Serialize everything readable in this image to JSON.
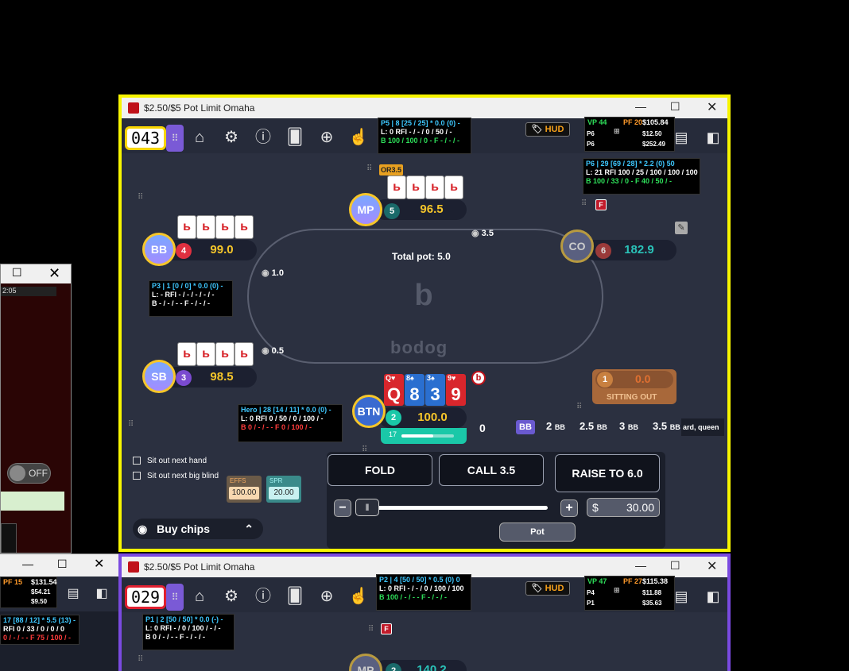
{
  "left_window_top": {
    "time_partial": "2:05",
    "toggle_label": "OFF"
  },
  "left_window_bottom": {
    "hud_vp": "PF 15",
    "hud_amt1": "$131.54",
    "hud_amt2": "$54.21",
    "hud_amt3": "$9.50",
    "hud_line1": "17 [88 / 12] * 5.5 (13) -",
    "hud_line2": "RFI 0 / 33 / 0 / 0 / 0",
    "hud_line3": "0 / - / - - F 75 / 100 / -"
  },
  "main": {
    "title": "$2.50/$5 Pot Limit Omaha",
    "hand_count": "043",
    "hud_button": "HUD",
    "vp_stats": {
      "vp": "VP 44",
      "pf": "PF 20",
      "amt1": "$105.84",
      "amt2": "$12.50",
      "amt3": "$252.49",
      "p1": "P6",
      "p2": "P6"
    },
    "p5_hud": {
      "l1": "P5 | 8 [25 / 25] * 0.0 (0) -",
      "l2": "L: 0 RFI - / - / 0 / 50 / -",
      "l3": "B 100 / 100 / 0 - F - / - / -"
    },
    "p6_hud": {
      "l1": "P6 | 29 [69 / 28] * 2.2 (0) 50",
      "l2": "L: 21 RFI 100 / 25 / 100 / 100 / 100",
      "l3": "B 100 / 33 / 0 - F 40 / 50 / -"
    },
    "p3_hud": {
      "l1": "P3 | 1 [0 / 0] * 0.0 (0) -",
      "l2": "L: - RFI - / - / - / - / -",
      "l3": "B - / - / - - F - / - / -"
    },
    "hero_hud": {
      "l1": "Hero | 28 [14 / 11] * 0.0 (0) -",
      "l2": "L: 0 RFI 0 / 50 / 0 / 100 / -",
      "l3": "B 0 / - / - - F 0 / 100 / -"
    },
    "or_label": "OR3.5",
    "f_badge": "F",
    "seats": {
      "mp": {
        "label": "MP",
        "num": "5",
        "stack": "96.5"
      },
      "bb": {
        "label": "BB",
        "num": "4",
        "stack": "99.0"
      },
      "co": {
        "label": "CO",
        "num": "6",
        "stack": "182.9"
      },
      "sb": {
        "label": "SB",
        "num": "3",
        "stack": "98.5"
      },
      "btn": {
        "label": "BTN",
        "num": "2",
        "stack": "100.0",
        "timer": "17"
      },
      "empty": {
        "num": "1",
        "stack": "0.0",
        "status": "SITTING OUT"
      }
    },
    "bets": {
      "co": "3.5",
      "bb": "1.0",
      "sb": "0.5"
    },
    "total_pot": "Total pot: 5.0",
    "brand": "bodog",
    "hero_cards": [
      {
        "rank": "Q",
        "suit": "♥",
        "color": "#d8262c"
      },
      {
        "rank": "8",
        "suit": "♠",
        "color": "#2a6fd0"
      },
      {
        "rank": "3",
        "suit": "♠",
        "color": "#2a6fd0"
      },
      {
        "rank": "9",
        "suit": "♥",
        "color": "#d8262c"
      }
    ],
    "bet_amount_display": "0",
    "bb_tag": "BB",
    "presets": [
      "2",
      "2.5",
      "3",
      "3.5"
    ],
    "preset_unit": "BB",
    "chat_text": "ard, queen",
    "options": {
      "sit_out_next": "Sit out next hand",
      "sit_out_bb": "Sit out next big blind"
    },
    "effs": {
      "label": "EFFS",
      "value": "100.00"
    },
    "spr": {
      "label": "SPR",
      "value": "20.00"
    },
    "buy_chips": "Buy chips",
    "actions": {
      "fold": "FOLD",
      "call": "CALL 3.5",
      "raise": "RAISE TO 6.0"
    },
    "bet_input": {
      "currency": "$",
      "value": "30.00"
    },
    "pot_button": "Pot"
  },
  "second": {
    "title": "$2.50/$5 Pot Limit Omaha",
    "hand_count": "029",
    "hud_button": "HUD",
    "vp_stats": {
      "vp": "VP 47",
      "pf": "PF 27",
      "amt1": "$115.38",
      "amt2": "$11.88",
      "amt3": "$35.63",
      "p1": "P4",
      "p2": "P1"
    },
    "p2_hud": {
      "l1": "P2 | 4 [50 / 50] * 0.5 (0) 0",
      "l2": "L: 0 RFI - / - / 0 / 100 / 100",
      "l3": "B 100 / - / - - F - / - / -"
    },
    "p1_hud": {
      "l1": "P1 | 2 [50 / 50] * 0.0 (-) -",
      "l2": "L: 0 RFI - / 0 / 100 / - / -",
      "l3": "B 0 / - / - - F - / - / -"
    },
    "f_badge": "F",
    "mp": {
      "label": "MP",
      "num": "2",
      "stack": "140.2"
    }
  }
}
